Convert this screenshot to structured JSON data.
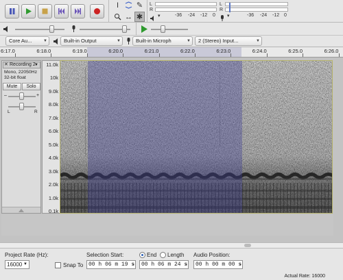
{
  "toolbar": {
    "meter_play": {
      "lr": [
        "L",
        "R"
      ],
      "scale": [
        "-36",
        "-24",
        "-12",
        "0"
      ]
    },
    "meter_rec": {
      "lr": [
        "L",
        "R"
      ],
      "scale": [
        "-36",
        "-24",
        "-12",
        "0"
      ]
    }
  },
  "devices": {
    "host": "Core Au...",
    "playback_device": "Built-in Output",
    "recording_device": "Built-in Microph",
    "channels": "2 (Stereo) Input..."
  },
  "ruler": {
    "ticks": [
      "6:17.0",
      "6:18.0",
      "6:19.0",
      "6:20.0",
      "6:21.0",
      "6:22.0",
      "6:23.0",
      "6:24.0",
      "6:25.0",
      "6:26.0"
    ]
  },
  "track": {
    "name": "Recording 2",
    "info_line1": "Mono, 22050Hz",
    "info_line2": "32-bit float",
    "mute_label": "Mute",
    "solo_label": "Solo",
    "pan_left": "L",
    "pan_right": "R",
    "freq_labels": [
      "11.0k",
      "10k",
      "9.0k",
      "8.0k",
      "7.0k",
      "6.0k",
      "5.0k",
      "4.0k",
      "3.0k",
      "2.0k",
      "1.0k",
      "0.1k"
    ]
  },
  "selection_bar": {
    "project_rate_label": "Project Rate (Hz):",
    "project_rate_value": "16000",
    "snap_to_label": "Snap To",
    "selection_start_label": "Selection Start:",
    "selection_start_value": "00 h 06 m 19 s",
    "end_label": "End",
    "length_label": "Length",
    "selection_end_value": "00 h 06 m 24 s",
    "audio_position_label": "Audio Position:",
    "audio_position_value": "00 h 00 m 00 s"
  },
  "status": {
    "actual_rate": "Actual Rate: 16000"
  },
  "colors": {
    "selection": "#3c3c96",
    "play_green": "#2e9a2e",
    "record_red": "#cc2222",
    "transport_blue": "#4a58b8"
  }
}
